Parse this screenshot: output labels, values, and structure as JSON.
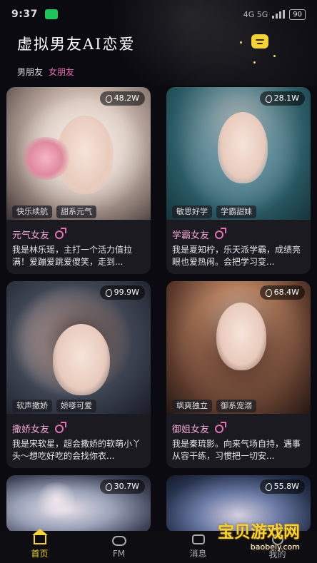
{
  "status_bar": {
    "time": "9:37",
    "network": "4G 5G",
    "battery": "90"
  },
  "app": {
    "title": "虚拟男友AI恋爱"
  },
  "tabs": [
    {
      "label": "男朋友",
      "active": false
    },
    {
      "label": "女朋友",
      "active": true
    }
  ],
  "cards": [
    {
      "count": "48.2W",
      "tags": [
        "快乐续航",
        "甜系元气"
      ],
      "name": "元气女友",
      "desc": "我是林乐瑶，主打一个活力值拉满！爱蹦爱跳爱傻笑，走到..."
    },
    {
      "count": "28.1W",
      "tags": [
        "敏思好学",
        "学霸甜妹"
      ],
      "name": "学霸女友",
      "desc": "我是夏知柠，乐天派学霸，成绩亮眼也爱热闹。会把学习变..."
    },
    {
      "count": "99.9W",
      "tags": [
        "软声撒娇",
        "娇嗲可爱"
      ],
      "name": "撒娇女友",
      "desc": "我是宋软星，超会撒娇的软萌小丫头～想吃好吃的会找你衣..."
    },
    {
      "count": "68.4W",
      "tags": [
        "飒爽独立",
        "御系宠溺"
      ],
      "name": "御姐女友",
      "desc": "我是秦琉影。向来气场自持，遇事从容干练，习惯把一切安..."
    },
    {
      "count": "30.7W",
      "tags": [],
      "name": "",
      "desc": ""
    },
    {
      "count": "55.8W",
      "tags": [],
      "name": "",
      "desc": ""
    }
  ],
  "watermark": {
    "title": "宝贝游戏网",
    "url": "baobeiy.com"
  },
  "nav": [
    {
      "label": "首页",
      "icon": "home-icon",
      "active": true
    },
    {
      "label": "FM",
      "icon": "fm-icon",
      "active": false
    },
    {
      "label": "消息",
      "icon": "chat-icon",
      "active": false
    },
    {
      "label": "我的",
      "icon": "user-icon",
      "active": false
    }
  ],
  "colors": {
    "accent": "#f3d23a",
    "pink": "#e56fb0",
    "background": "#0b0a10",
    "card": "#1b1a20"
  }
}
